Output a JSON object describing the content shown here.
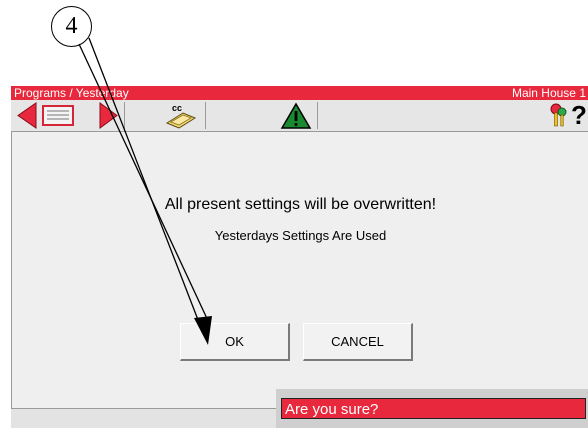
{
  "callout": {
    "number": "4"
  },
  "titlebar": {
    "left_title": "Programs / Yesterday",
    "right_title": "Main House 1"
  },
  "toolbar": {
    "icons": [
      "back-arrow-icon",
      "list-view-icon",
      "forward-arrow-icon",
      "copy-settings-icon",
      "alarm-warning-icon",
      "keys-icon",
      "help-icon"
    ],
    "copy_label": "cc",
    "help_label": "?"
  },
  "dialog": {
    "message": "All present settings will be overwritten!",
    "sub_message": "Yesterdays Settings Are Used",
    "ok_label": "OK",
    "cancel_label": "CANCEL"
  },
  "confirm": {
    "text": "Are you sure?"
  },
  "colors": {
    "accent_red": "#e8283c",
    "warning_green": "#1a8a2e"
  }
}
